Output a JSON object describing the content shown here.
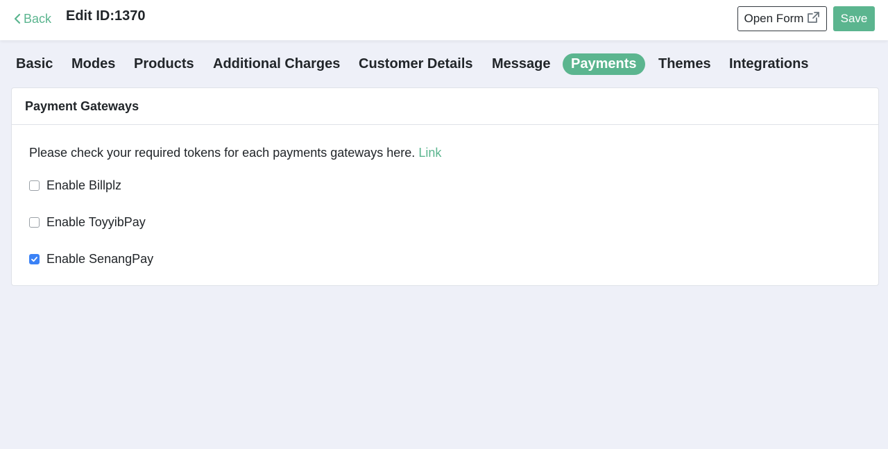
{
  "header": {
    "back_label": "Back",
    "title": "Edit ID:1370",
    "open_form_label": "Open Form",
    "save_label": "Save"
  },
  "tabs": [
    {
      "label": "Basic",
      "active": false
    },
    {
      "label": "Modes",
      "active": false
    },
    {
      "label": "Products",
      "active": false
    },
    {
      "label": "Additional Charges",
      "active": false
    },
    {
      "label": "Customer Details",
      "active": false
    },
    {
      "label": "Message",
      "active": false
    },
    {
      "label": "Payments",
      "active": true
    },
    {
      "label": "Themes",
      "active": false
    },
    {
      "label": "Integrations",
      "active": false
    }
  ],
  "card": {
    "title": "Payment Gateways",
    "intro_text": "Please check your required tokens for each payments gateways here.",
    "intro_link": "Link",
    "gateways": [
      {
        "label": "Enable Billplz",
        "checked": false
      },
      {
        "label": "Enable ToyyibPay",
        "checked": false
      },
      {
        "label": "Enable SenangPay",
        "checked": true
      }
    ]
  },
  "colors": {
    "accent": "#5bb58f",
    "checkbox_checked": "#3b82f6",
    "background": "#eef0f8"
  },
  "icons": {
    "back": "chevron-left-icon",
    "open_form": "external-link-icon",
    "checkmark": "check-icon"
  }
}
